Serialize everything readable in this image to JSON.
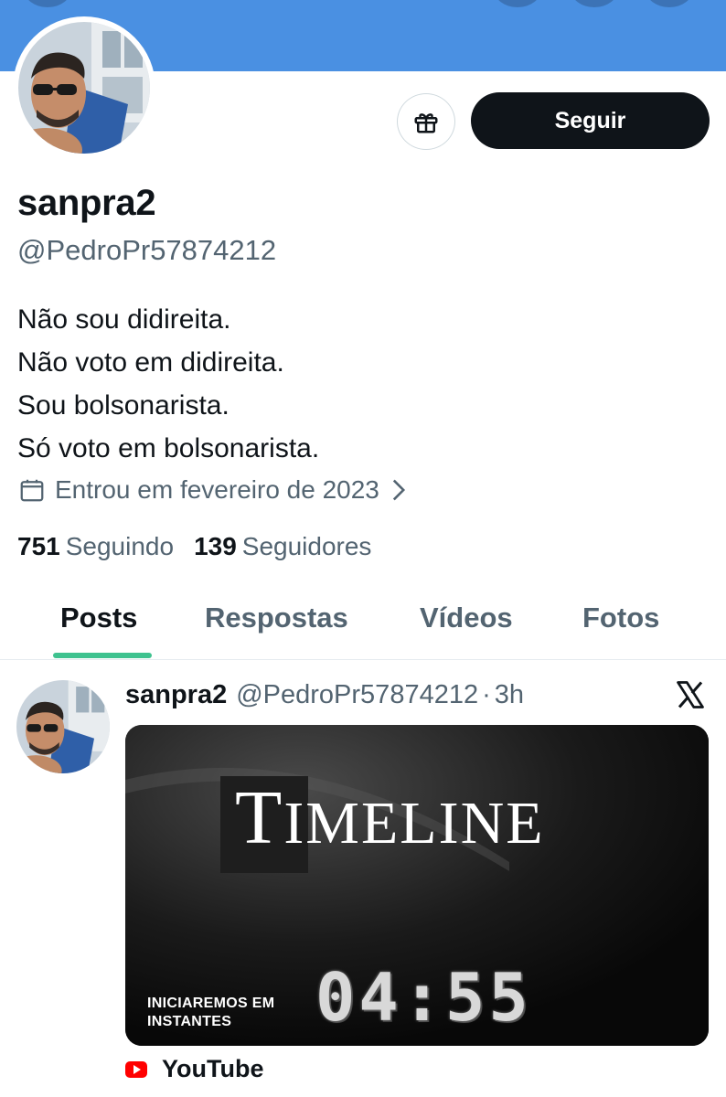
{
  "profile": {
    "display_name": "sanpra2",
    "handle": "@PedroPr57874212",
    "bio": [
      "Não sou didireita.",
      "Não voto em didireita.",
      "Sou bolsonarista.",
      "Só voto em bolsonarista."
    ],
    "joined": "Entrou em fevereiro de 2023",
    "following_count": "751",
    "following_label": "Seguindo",
    "followers_count": "139",
    "followers_label": "Seguidores"
  },
  "actions": {
    "follow_label": "Seguir",
    "gift_icon": "gift-icon"
  },
  "tabs": [
    {
      "label": "Posts",
      "active": true
    },
    {
      "label": "Respostas",
      "active": false
    },
    {
      "label": "Vídeos",
      "active": false
    },
    {
      "label": "Fotos",
      "active": false
    }
  ],
  "post": {
    "author_name": "sanpra2",
    "author_handle": "@PedroPr57874212",
    "separator": "·",
    "time": "3h",
    "media": {
      "title_first": "T",
      "title_rest": "IMELINE",
      "subtitle_line1": "INICIAREMOS EM",
      "subtitle_line2": "INSTANTES",
      "timer": "04:55"
    },
    "source": "YouTube"
  },
  "colors": {
    "banner": "#4a90e2",
    "primary_text": "#0f1419",
    "secondary_text": "#536471",
    "tab_indicator": "#3ec28f",
    "youtube": "#ff0000"
  }
}
